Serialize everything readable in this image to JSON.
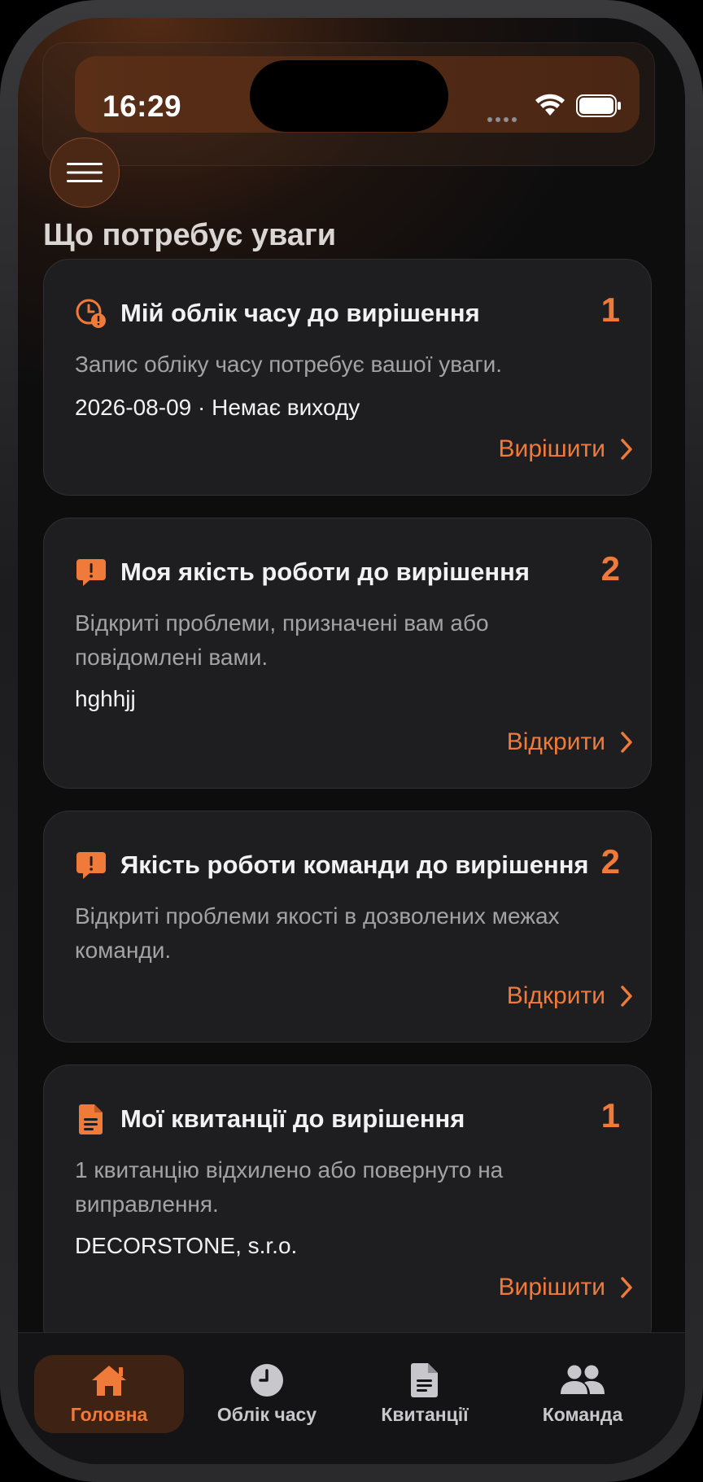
{
  "status_bar": {
    "time": "16:29"
  },
  "section_title": "Що потребує уваги",
  "cards": [
    {
      "title": "Мій облік часу до вирішення",
      "count": "1",
      "description": "Запис обліку часу потребує вашої уваги.",
      "meta": "2026-08-09 · Немає виходу",
      "action": "Вирішити",
      "icon": "clock-alert-icon"
    },
    {
      "title": "Моя якість роботи до вирішення",
      "count": "2",
      "description": "Відкриті проблеми, призначені вам або повідомлені вами.",
      "meta": "hghhjj",
      "action": "Відкрити",
      "icon": "message-alert-icon"
    },
    {
      "title": "Якість роботи команди до вирішення",
      "count": "2",
      "description": "Відкриті проблеми якості в дозволених межах команди.",
      "action": "Відкрити",
      "icon": "message-alert-icon"
    },
    {
      "title": "Мої квитанції до вирішення",
      "count": "1",
      "description": "1 квитанцію відхилено або повернуто на виправлення.",
      "meta": "DECORSTONE, s.r.o.",
      "action": "Вирішити",
      "icon": "document-icon"
    }
  ],
  "tabs": [
    {
      "label": "Головна",
      "icon": "home-icon",
      "active": true
    },
    {
      "label": "Облік часу",
      "icon": "clock-icon",
      "active": false
    },
    {
      "label": "Квитанції",
      "icon": "document-icon",
      "active": false
    },
    {
      "label": "Команда",
      "icon": "team-icon",
      "active": false
    }
  ],
  "colors": {
    "accent": "#f07a3a",
    "card_bg": "#1e1e20",
    "background": "#0d0d0e"
  }
}
